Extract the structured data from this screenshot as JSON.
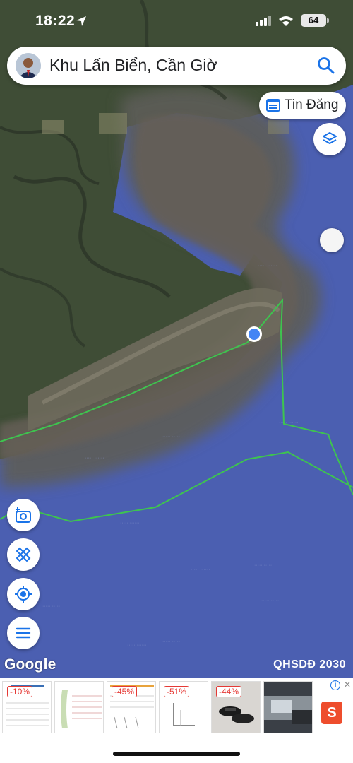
{
  "status_bar": {
    "time": "18:22",
    "battery": "64"
  },
  "search": {
    "query": "Khu Lấn Biển, Cần Giờ",
    "icon": "search-icon"
  },
  "chips": {
    "tin_dang": "Tin Đăng"
  },
  "map": {
    "attribution_logo": "Google",
    "layer_label": "QHSDĐ 2030",
    "colors": {
      "sea": "#4a62b5",
      "land": "#4d5a3f",
      "boundary": "#3ec44f",
      "location": "#4285f4"
    }
  },
  "controls": {
    "camera": "add-photo-icon",
    "ruler": "ruler-pencil-icon",
    "locate": "my-location-icon",
    "menu": "menu-icon",
    "layers": "layers-icon"
  },
  "ads": [
    {
      "badge": "-10%"
    },
    {
      "badge": ""
    },
    {
      "badge": "-45%"
    },
    {
      "badge": "-51%"
    },
    {
      "badge": "-44%"
    },
    {
      "badge": ""
    }
  ],
  "ad_brand": "S"
}
